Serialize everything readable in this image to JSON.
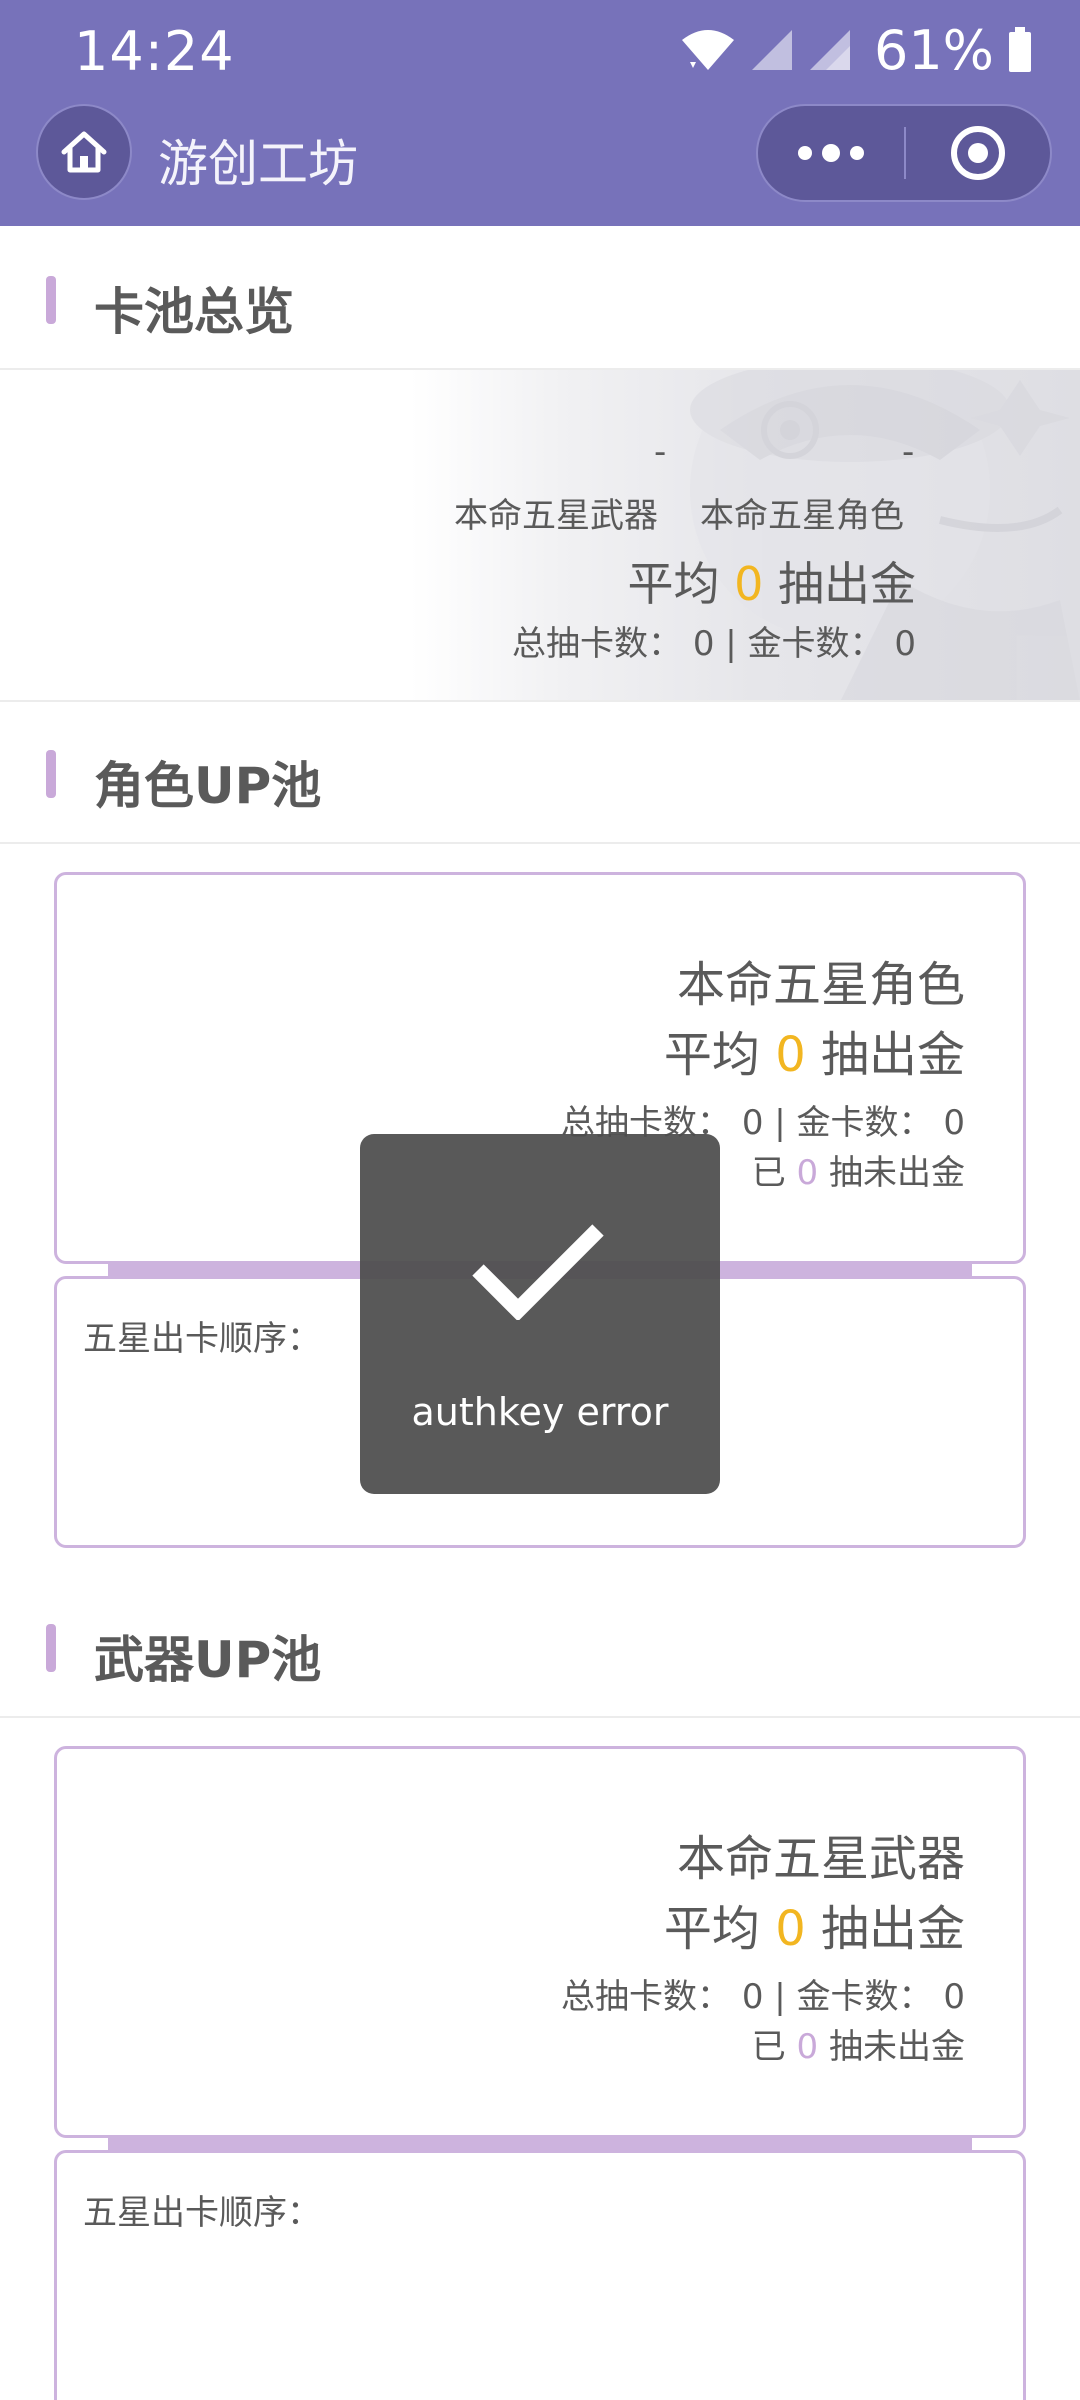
{
  "status_bar": {
    "time": "14:24",
    "battery": "61%"
  },
  "nav": {
    "title": "游创工坊",
    "icons": [
      "home-icon",
      "more-icon",
      "close-target-icon"
    ]
  },
  "overview": {
    "section_title": "卡池总览",
    "weapon_dash": "-",
    "character_dash": "-",
    "weapon_label": "本命五星武器",
    "character_label": "本命五星角色",
    "avg_prefix": "平均 ",
    "avg_value": "0",
    "avg_suffix": " 抽出金",
    "total_line": "总抽卡数： 0 | 金卡数： 0"
  },
  "character_pool": {
    "section_title": "角色UP池",
    "name": "本命五星角色",
    "avg_prefix": "平均 ",
    "avg_value": "0",
    "avg_suffix": " 抽出金",
    "total_line": "总抽卡数： 0 | 金卡数： 0",
    "since_prefix": "已 ",
    "since_value": "0",
    "since_suffix": " 抽未出金",
    "order_label": "五星出卡顺序："
  },
  "weapon_pool": {
    "section_title": "武器UP池",
    "name": "本命五星武器",
    "avg_prefix": "平均 ",
    "avg_value": "0",
    "avg_suffix": " 抽出金",
    "total_line": "总抽卡数： 0 | 金卡数： 0",
    "since_prefix": "已 ",
    "since_value": "0",
    "since_suffix": " 抽未出金",
    "order_label": "五星出卡顺序："
  },
  "toast": {
    "icon": "checkmark-icon",
    "message": "authkey error"
  },
  "colors": {
    "header": "#7772ba",
    "accent": "#c9a9d9",
    "gold": "#f2b621",
    "card_border": "#cdb3de",
    "toast_bg": "#4c4c4c"
  }
}
